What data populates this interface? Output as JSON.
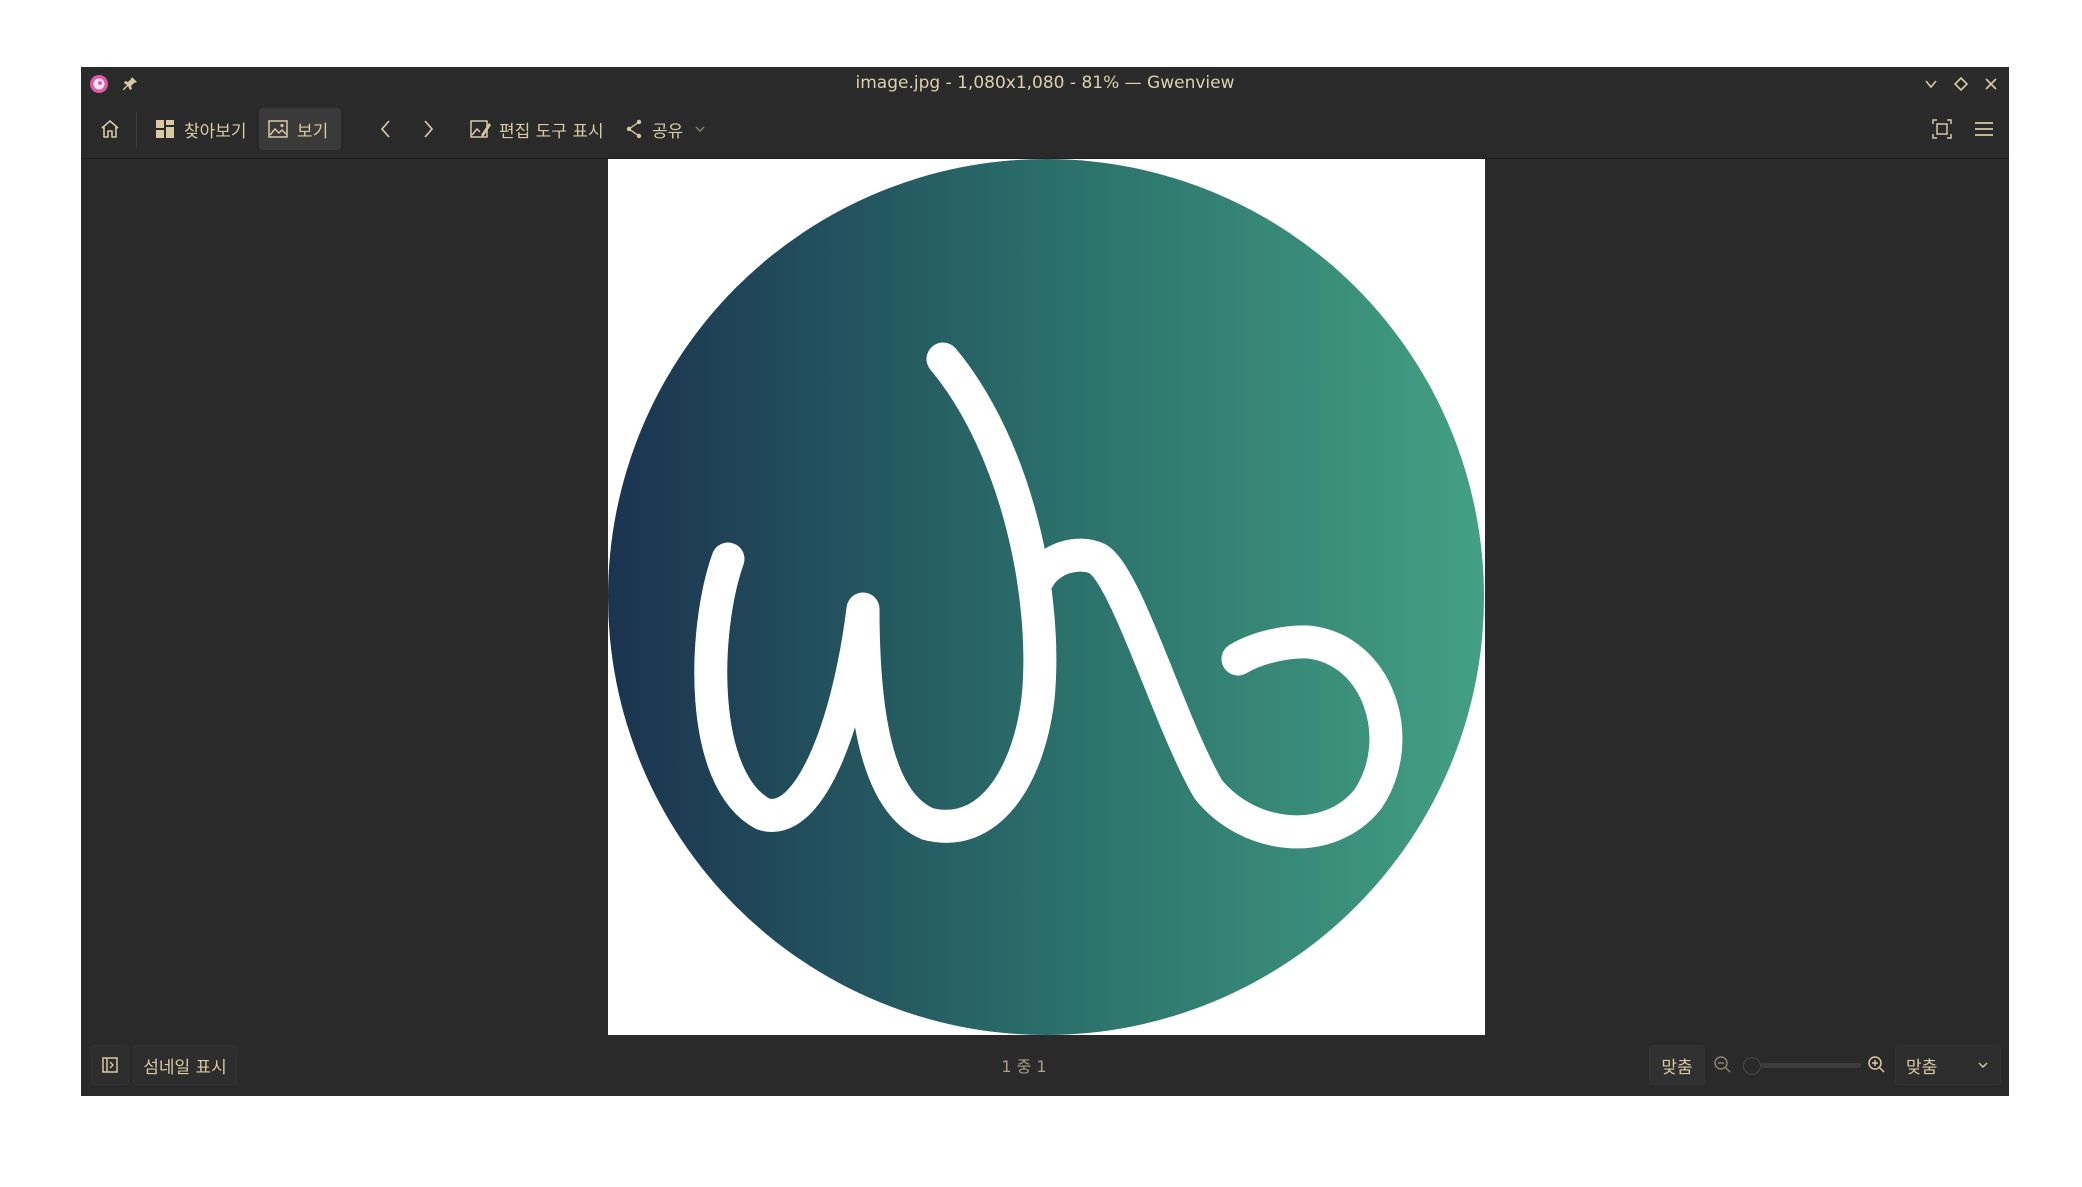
{
  "window": {
    "title": "image.jpg - 1,080x1,080 - 81% — Gwenview"
  },
  "toolbar": {
    "browse_label": "찾아보기",
    "view_label": "보기",
    "edit_tools_label": "편집 도구 표시",
    "share_label": "공유"
  },
  "statusbar": {
    "thumbnails_label": "섬네일 표시",
    "page_info": "1 중 1",
    "fit_label": "맞춤",
    "zoom_select_value": "맞춤"
  },
  "colors": {
    "window_bg": "#2a2a2a",
    "text": "#d8c9a3",
    "logo_gradient_start": "#1b3350",
    "logo_gradient_mid": "#2a6e6a",
    "logo_gradient_end": "#43a083"
  },
  "icons": [
    "app-icon",
    "pin-icon",
    "minimize-icon",
    "maximize-icon",
    "close-icon",
    "home-icon",
    "grid-icon",
    "image-icon",
    "chevron-left-icon",
    "chevron-right-icon",
    "edit-image-icon",
    "share-icon",
    "chevron-down-icon",
    "fullscreen-icon",
    "hamburger-menu-icon",
    "sidebar-toggle-icon",
    "zoom-out-icon",
    "zoom-in-icon"
  ]
}
